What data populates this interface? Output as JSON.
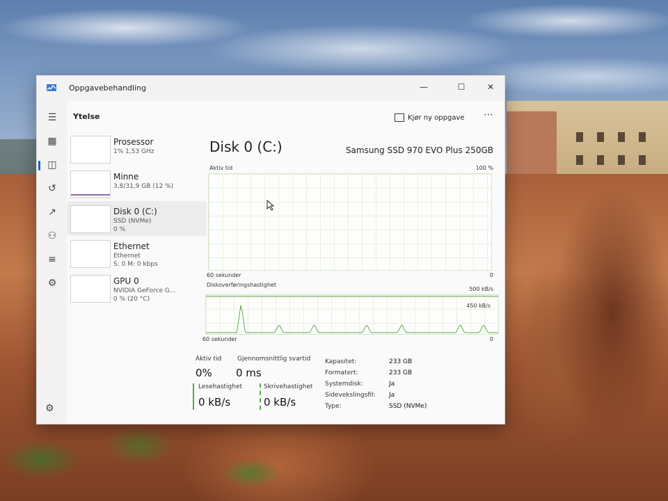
{
  "window": {
    "title": "Oppgavebehandling",
    "controls": {
      "minimize": "—",
      "maximize": "☐",
      "close": "✕"
    }
  },
  "header": {
    "title": "Ytelse",
    "run_task": "Kjør ny oppgave",
    "more": "⋯"
  },
  "nav": {
    "items": [
      {
        "name": "menu",
        "glyph": "☰"
      },
      {
        "name": "processes",
        "glyph": "▦"
      },
      {
        "name": "performance",
        "glyph": "◫",
        "active": true
      },
      {
        "name": "app-history",
        "glyph": "↺"
      },
      {
        "name": "startup",
        "glyph": "↗"
      },
      {
        "name": "users",
        "glyph": "⚇"
      },
      {
        "name": "details",
        "glyph": "≡"
      },
      {
        "name": "services",
        "glyph": "⚙"
      }
    ],
    "settings": "⚙"
  },
  "devices": [
    {
      "name": "Prosessor",
      "sub1": "1% 1,53 GHz",
      "sub2": ""
    },
    {
      "name": "Minne",
      "sub1": "3,8/31,9 GB (12 %)",
      "sub2": ""
    },
    {
      "name": "Disk 0 (C:)",
      "sub1": "SSD (NVMe)",
      "sub2": "0 %",
      "selected": true
    },
    {
      "name": "Ethernet",
      "sub1": "Ethernet",
      "sub2": "S: 0 M: 0 kbps"
    },
    {
      "name": "GPU 0",
      "sub1": "NVIDIA GeForce G...",
      "sub2": "0 % (20 °C)"
    }
  ],
  "detail": {
    "title": "Disk 0 (C:)",
    "model": "Samsung SSD 970 EVO Plus 250GB",
    "graph1": {
      "label": "Aktiv tid",
      "max": "100 %",
      "bottom_left": "60 sekunder",
      "bottom_right": "0"
    },
    "graph2": {
      "label": "Diskoverføringshastighet",
      "max": "500 kB/s",
      "mid": "450 kB/s",
      "bottom_left": "60 sekunder",
      "bottom_right": "0",
      "spikes": [
        0.12,
        0.25,
        0.37,
        0.55,
        0.67,
        0.87,
        0.95
      ]
    },
    "stats": {
      "active_time_label": "Aktiv tid",
      "active_time_value": "0%",
      "response_label": "Gjennomsnittlig svartid",
      "response_value": "0 ms",
      "read_label": "Lesehastighet",
      "read_value": "0 kB/s",
      "write_label": "Skrivehastighet",
      "write_value": "0 kB/s"
    },
    "properties": [
      {
        "key": "Kapasitet:",
        "value": "233 GB"
      },
      {
        "key": "Formatert:",
        "value": "233 GB"
      },
      {
        "key": "Systemdisk:",
        "value": "Ja"
      },
      {
        "key": "Sidevekslingsfil:",
        "value": "Ja"
      },
      {
        "key": "Type:",
        "value": "SSD (NVMe)"
      }
    ]
  },
  "colors": {
    "accent": "#1a5fb4",
    "disk_green": "#5aa74a",
    "memory_purple": "#8e6aa3"
  }
}
